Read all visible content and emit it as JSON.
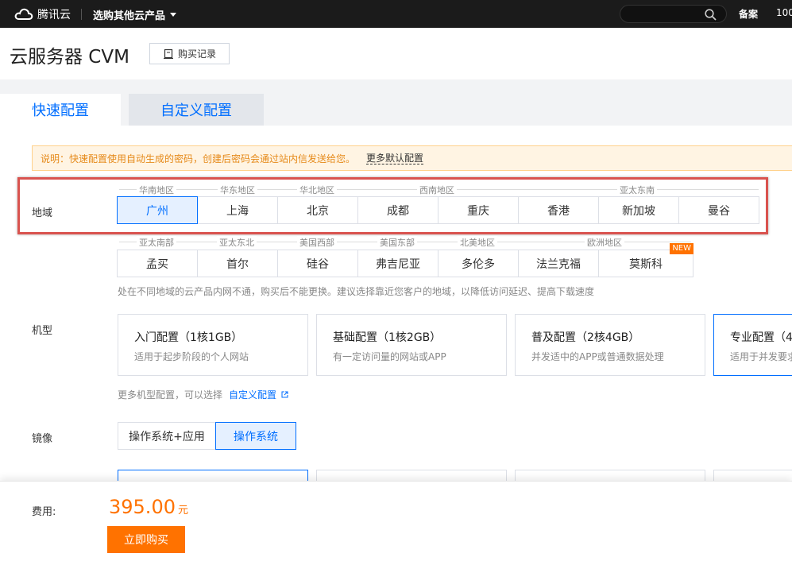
{
  "topbar": {
    "logo_text": "腾讯云",
    "product_switch": "选购其他云产品",
    "search": {
      "placeholder": ""
    },
    "nav_beian": "备案",
    "nav_num": "100"
  },
  "header": {
    "title": "云服务器 CVM",
    "history_button": "购买记录"
  },
  "tabs": [
    {
      "label": "快速配置",
      "active": true
    },
    {
      "label": "自定义配置",
      "active": false
    }
  ],
  "notice": {
    "text": "说明：快速配置使用自动生成的密码，创建后密码会通过站内信发送给您。",
    "more_link": "更多默认配置"
  },
  "region": {
    "label": "地域",
    "groups_row1": [
      "华南地区",
      "华东地区",
      "华北地区",
      "西南地区",
      "亚太东南"
    ],
    "row1": [
      "广州",
      "上海",
      "北京",
      "成都",
      "重庆",
      "香港",
      "新加坡",
      "曼谷"
    ],
    "selected": "广州",
    "groups_row2": [
      "亚太南部",
      "亚太东北",
      "美国西部",
      "美国东部",
      "北美地区",
      "欧洲地区"
    ],
    "row2": [
      "孟买",
      "首尔",
      "硅谷",
      "弗吉尼亚",
      "多伦多",
      "法兰克福",
      "莫斯科"
    ],
    "new_badge": "NEW",
    "hint": "处在不同地域的云产品内网不通，购买后不能更换。建议选择靠近您客户的地域，以降低访问延迟、提高下载速度"
  },
  "model": {
    "label": "机型",
    "cards": [
      {
        "name": "入门配置（1核1GB）",
        "desc": "适用于起步阶段的个人网站"
      },
      {
        "name": "基础配置（1核2GB）",
        "desc": "有一定访问量的网站或APP"
      },
      {
        "name": "普及配置（2核4GB）",
        "desc": "并发适中的APP或普通数据处理"
      },
      {
        "name": "专业配置（4",
        "desc": "适用于并发要求"
      }
    ],
    "hint": "更多机型配置，可以选择",
    "hint_link": "自定义配置"
  },
  "image": {
    "label": "镜像",
    "options": [
      "操作系统+应用",
      "操作系统"
    ],
    "selected": "操作系统"
  },
  "footer": {
    "fee_label": "费用:",
    "price": "395.00",
    "unit": "元",
    "buy_button": "立即购买"
  },
  "colors": {
    "accent": "#006eff",
    "price": "#ff7200",
    "highlight": "#d9534f"
  }
}
